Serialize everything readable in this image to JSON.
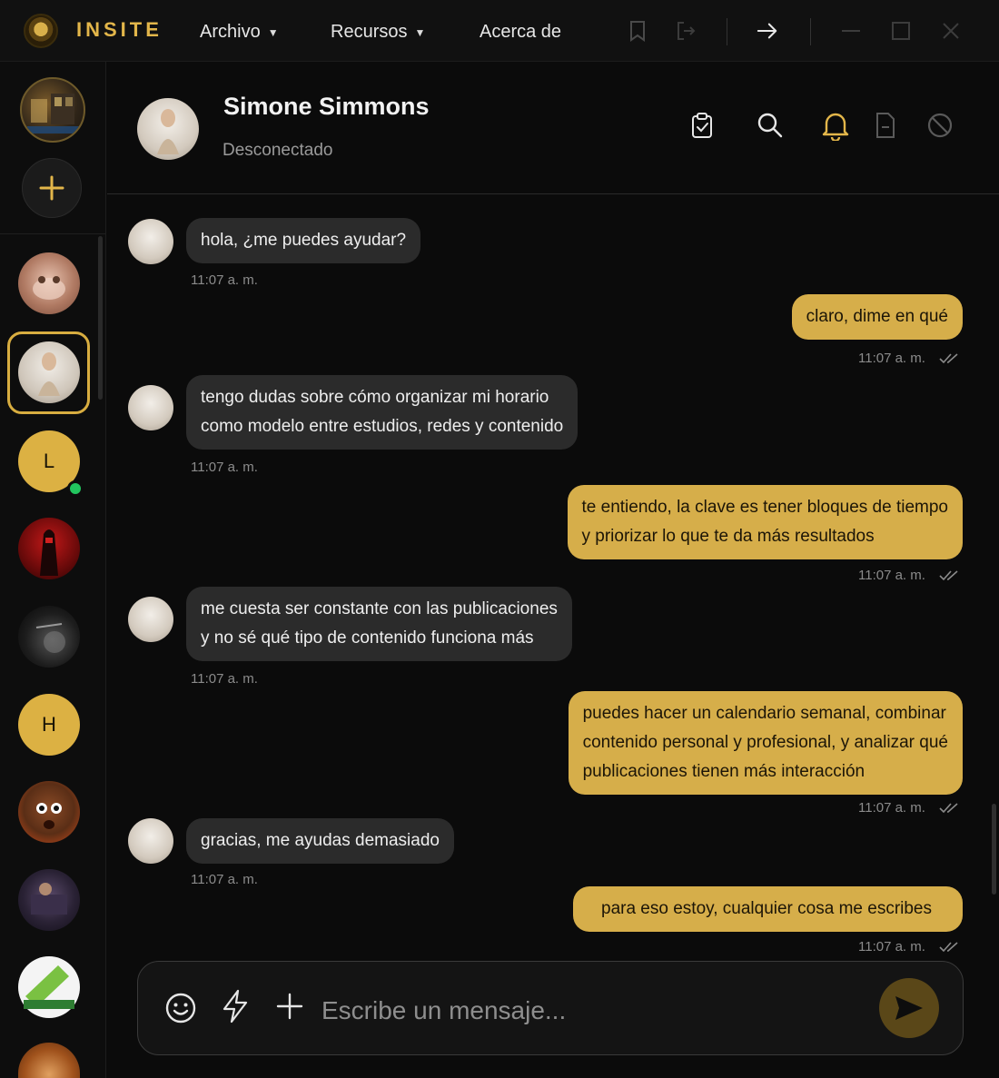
{
  "app": {
    "brand": "INSITE"
  },
  "menu": {
    "file": "Archivo",
    "resources": "Recursos",
    "about": "Acerca de"
  },
  "colors": {
    "accent": "#d6ae4a",
    "online": "#22c55e",
    "incoming_bubble": "#2b2b2b",
    "background": "#0b0b0b"
  },
  "rail": {
    "contacts": [
      {
        "type": "photo",
        "icon": "profile-photo"
      },
      {
        "type": "photo",
        "icon": "profile-photo",
        "selected": true
      },
      {
        "type": "letter",
        "letter": "L",
        "online": true
      },
      {
        "type": "photo",
        "icon": "profile-photo"
      },
      {
        "type": "photo",
        "icon": "profile-photo"
      },
      {
        "type": "letter",
        "letter": "H"
      },
      {
        "type": "photo",
        "icon": "profile-photo"
      },
      {
        "type": "photo",
        "icon": "profile-photo"
      },
      {
        "type": "photo",
        "icon": "profile-photo"
      },
      {
        "type": "photo",
        "icon": "profile-photo"
      }
    ]
  },
  "chat": {
    "name": "Simone Simmons",
    "status": "Desconectado",
    "messages": [
      {
        "dir": "in",
        "text": [
          "hola, ¿me puedes ayudar?"
        ],
        "time": "11:07 a. m."
      },
      {
        "dir": "out",
        "text": [
          "claro, dime en qué"
        ],
        "time": "11:07 a. m."
      },
      {
        "dir": "in",
        "text": [
          "tengo dudas sobre cómo organizar mi horario",
          "como modelo entre estudios, redes y contenido"
        ],
        "time": "11:07 a. m."
      },
      {
        "dir": "out",
        "text": [
          "te entiendo, la clave es tener bloques de tiempo",
          "y priorizar lo que te da más resultados"
        ],
        "time": "11:07 a. m."
      },
      {
        "dir": "in",
        "text": [
          "me cuesta ser constante con las publicaciones",
          "y no sé qué tipo de contenido funciona más"
        ],
        "time": "11:07 a. m."
      },
      {
        "dir": "out",
        "text": [
          "puedes hacer un calendario semanal, combinar",
          "contenido personal y profesional, y analizar qué",
          "publicaciones tienen más interacción"
        ],
        "time": "11:07 a. m."
      },
      {
        "dir": "in",
        "text": [
          "gracias, me ayudas demasiado"
        ],
        "time": "11:07 a. m."
      },
      {
        "dir": "out",
        "text": [
          "para eso estoy, cualquier cosa me escribes"
        ],
        "time": "11:07 a. m."
      }
    ]
  },
  "composer": {
    "placeholder": "Escribe un mensaje..."
  }
}
